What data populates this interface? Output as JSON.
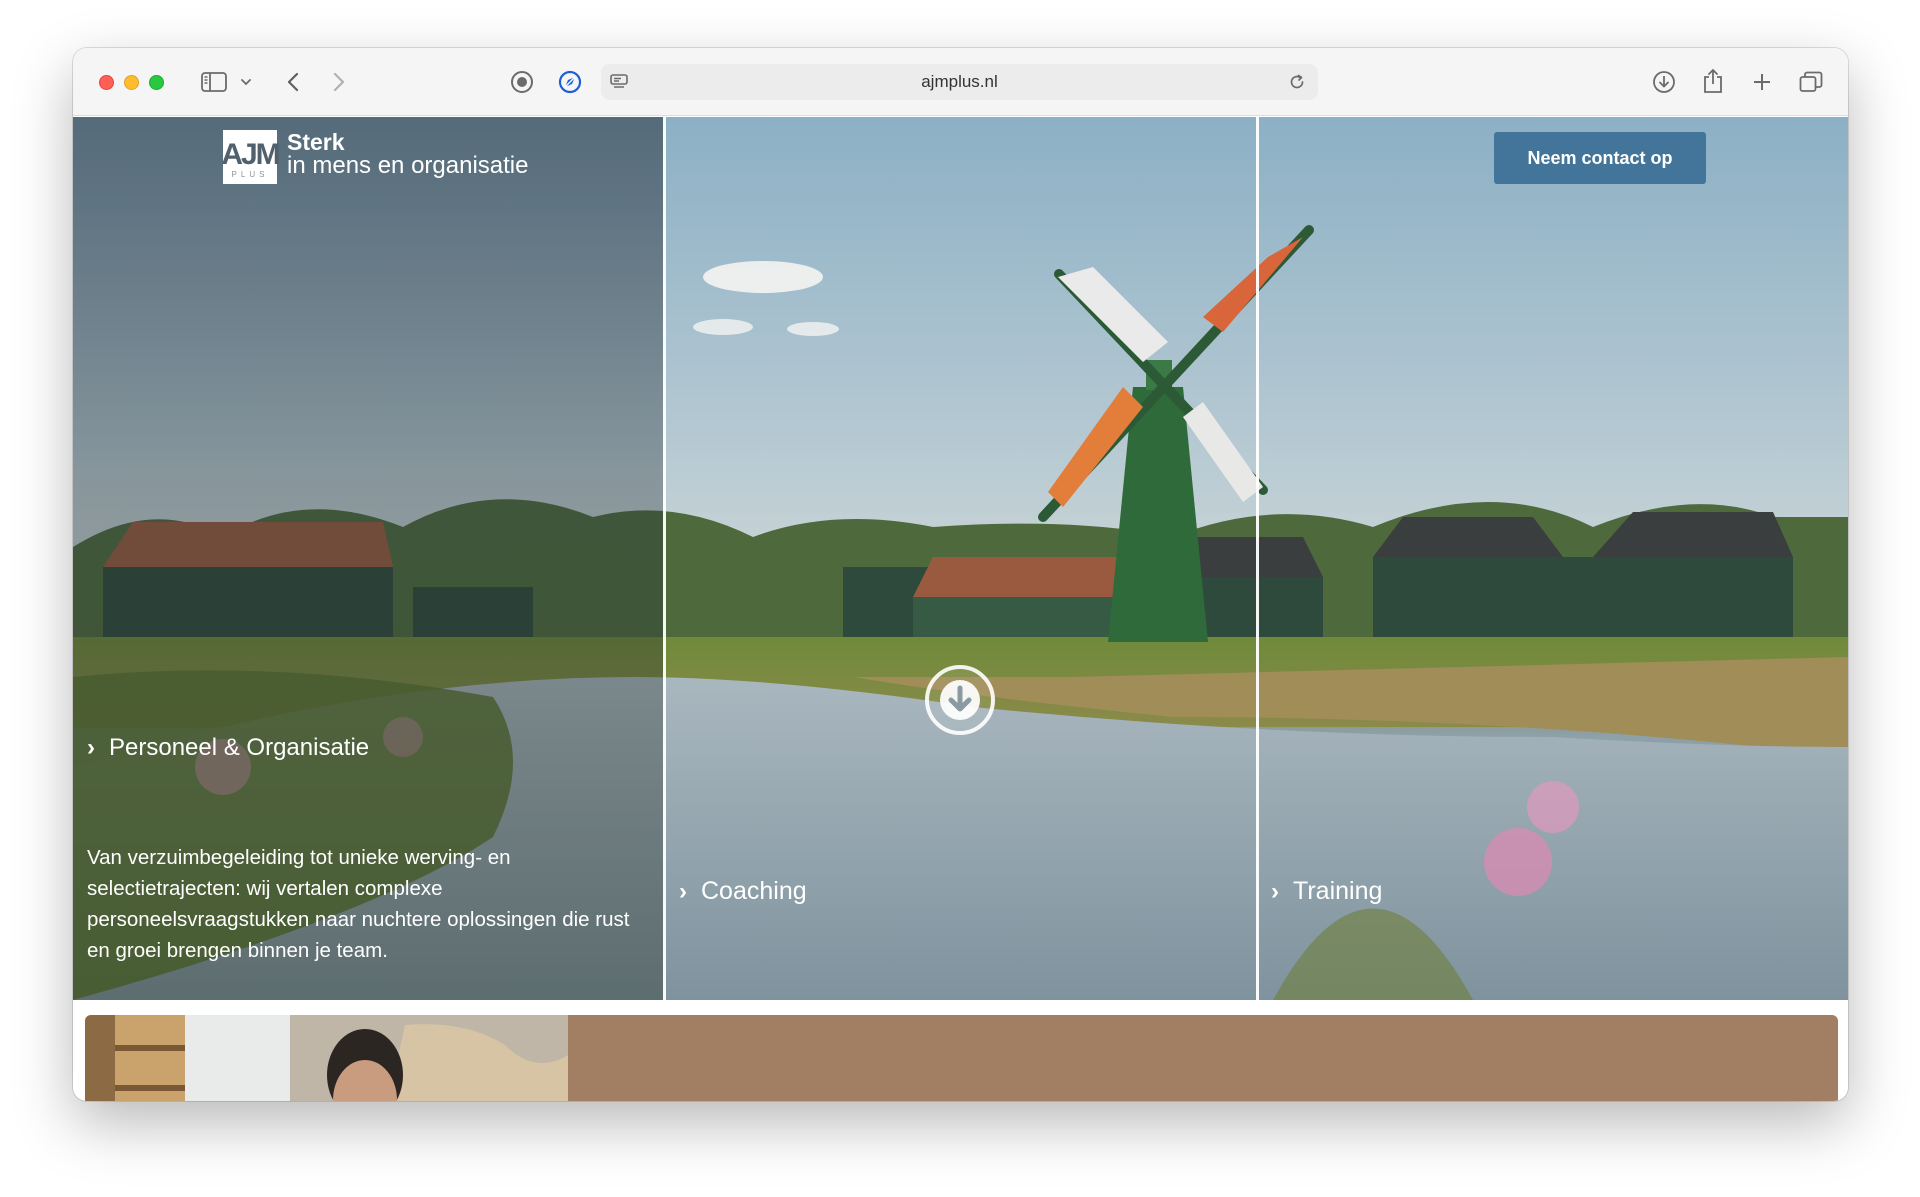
{
  "browser": {
    "url": "ajmplus.nl",
    "icons": {
      "sidebar": "sidebar-icon",
      "chevron": "chevron-down-icon",
      "back": "back-arrow-icon",
      "forward": "forward-arrow-icon",
      "privacy": "privacy-report-icon",
      "extension": "extension-compass-icon",
      "page_menu": "page-menu-icon",
      "reload": "reload-icon",
      "download": "download-icon",
      "share": "share-icon",
      "new_tab": "plus-icon",
      "tabs": "tab-overview-icon"
    }
  },
  "header": {
    "logo_mark": "AJM",
    "logo_plus": "PLUS",
    "logo_title": "Sterk",
    "logo_subtitle": "in mens en organisatie",
    "cta_label": "Neem contact op"
  },
  "panels": [
    {
      "title": "Personeel & Organisatie",
      "description": "Van verzuimbegeleiding tot unieke werving- en selectietrajecten: wij vertalen complexe personeelsvraagstukken naar nuchtere oplossingen die rust en groei brengen binnen je team."
    },
    {
      "title": "Coaching"
    },
    {
      "title": "Training"
    }
  ],
  "colors": {
    "cta": "#43749a",
    "card": "#a27e63"
  }
}
